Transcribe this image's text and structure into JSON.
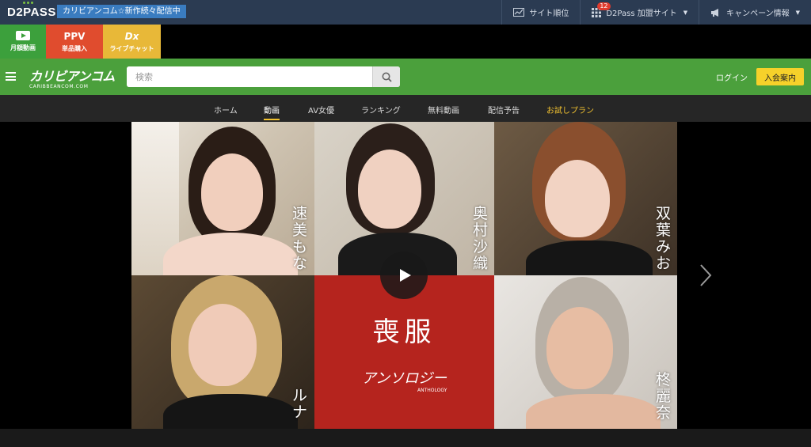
{
  "topbar": {
    "logo": "D2PASS",
    "notice": "カリビアンコム☆新作続々配信中",
    "items": [
      {
        "label": "サイト順位",
        "icon": "chart-icon"
      },
      {
        "label": "D2Pass 加盟サイト",
        "icon": "grid-icon",
        "badge": "12"
      },
      {
        "label": "キャンペーン情報",
        "icon": "megaphone-icon"
      }
    ]
  },
  "tiles": {
    "monthly": {
      "label": "月額動画"
    },
    "ppv": {
      "title": "PPV",
      "label": "単品購入"
    },
    "live": {
      "title": "Dx",
      "label": "ライブチャット"
    }
  },
  "header": {
    "brand_jp": "カリビアンコム",
    "brand_en": "CARIBBEANCOM.COM",
    "search_placeholder": "検索",
    "login": "ログイン",
    "join": "入会案内"
  },
  "nav": {
    "items": [
      "ホーム",
      "動画",
      "AV女優",
      "ランキング",
      "無料動画",
      "配信予告",
      "お試しプラン"
    ],
    "active": "動画"
  },
  "hero": {
    "names": [
      "速美もな",
      "奥村沙織",
      "双葉みお",
      "ルナ",
      "柊麗奈"
    ],
    "center_title": "喪服",
    "center_sub": "アンソロジー",
    "center_sub_en": "ANTHOLOGY",
    "center_color": "#b5241e"
  }
}
